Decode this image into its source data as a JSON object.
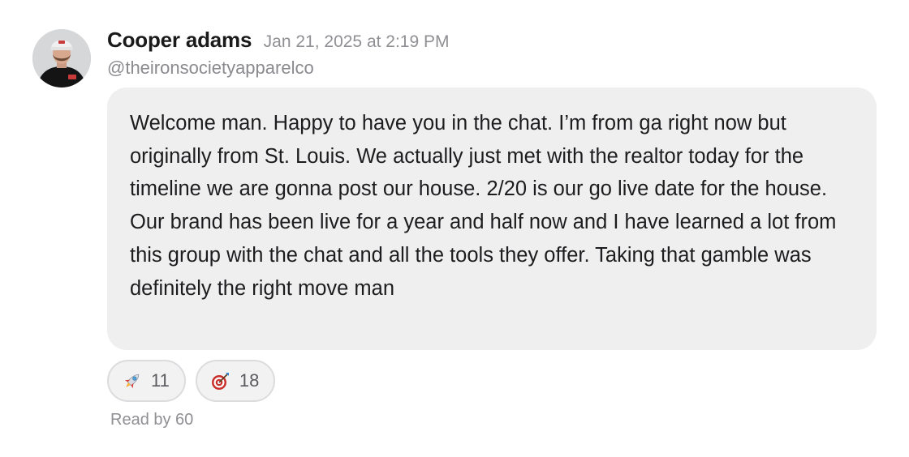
{
  "message": {
    "author": "Cooper adams",
    "timestamp": "Jan 21, 2025 at 2:19 PM",
    "handle": "@theironsocietyapparelco",
    "text": "Welcome man. Happy to have you in the chat. I’m from ga right now but originally from St. Louis. We actually just met with the realtor today for the timeline we are gonna post our house. 2/20 is our go live date for the house. Our brand has been live for a year and half now and I have learned a lot from this group with the chat and all the tools they offer. Taking that gamble was definitely the right move man"
  },
  "reactions": [
    {
      "emoji": "rocket-icon",
      "count": "11"
    },
    {
      "emoji": "target-icon",
      "count": "18"
    }
  ],
  "read_by": "Read by 60",
  "colors": {
    "bubble_background": "#efeff0",
    "reaction_border": "#dcdcdf",
    "muted_text": "#8f8f94"
  }
}
